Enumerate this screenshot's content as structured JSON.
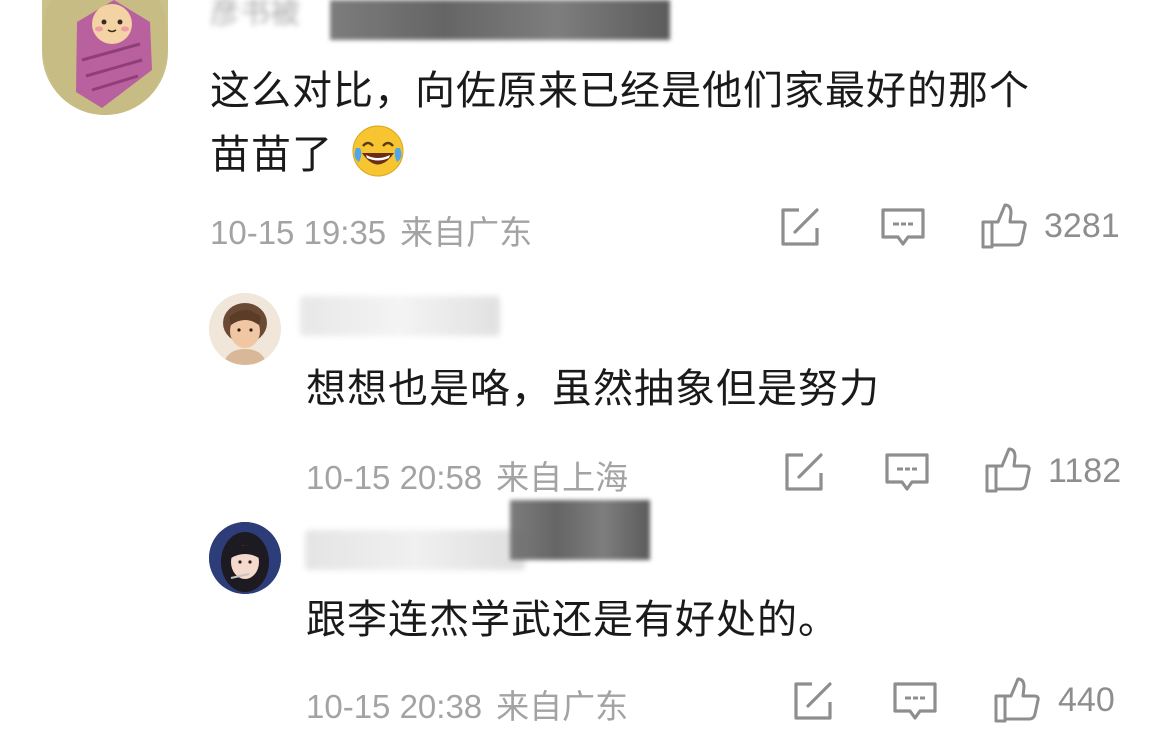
{
  "comments": [
    {
      "username": "彦书被",
      "text_line1": "这么对比，向佐原来已经是他们家最好的那个",
      "text_line2": "苗苗了",
      "emoji": "laughing-tears-emoji",
      "date": "10-15 19:35",
      "location": "来自广东",
      "likes": "3281"
    },
    {
      "username": "",
      "text": "想想也是咯，虽然抽象但是努力",
      "date": "10-15 20:58",
      "location": "来自上海",
      "likes": "1182"
    },
    {
      "username": "",
      "text": "跟李连杰学武还是有好处的。",
      "date": "10-15 20:38",
      "location": "来自广东",
      "likes": "440"
    }
  ],
  "icons": {
    "share": "share-edit-icon",
    "reply": "comment-icon",
    "like": "thumbs-up-icon"
  },
  "colors": {
    "text": "#1a1a1a",
    "meta": "#a3a3a3",
    "icon": "#8e8e8e",
    "emoji_face": "#f7c531"
  }
}
